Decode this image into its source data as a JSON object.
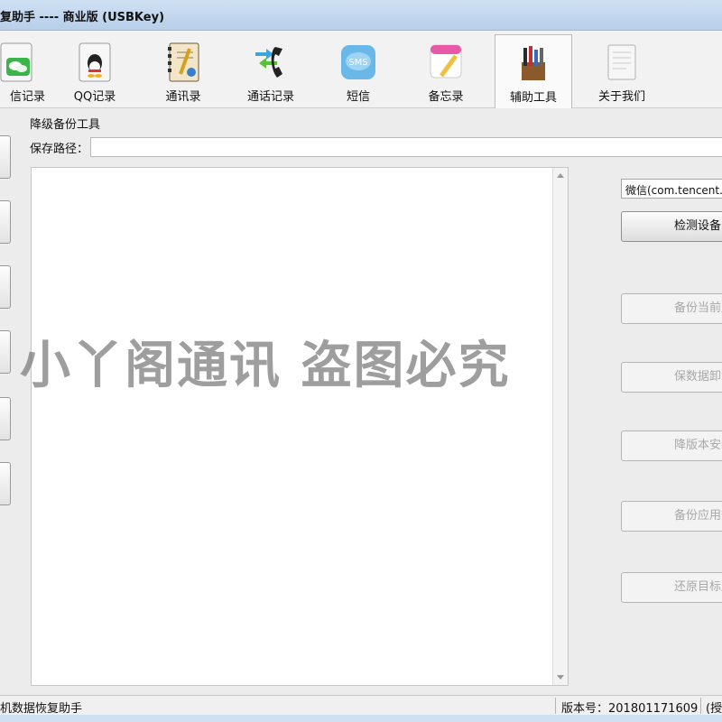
{
  "window": {
    "title": "复助手    ----    商业版 (USBKey)"
  },
  "toolbar": {
    "items": [
      {
        "label": "信记录",
        "icon": "wechat-icon"
      },
      {
        "label": "QQ记录",
        "icon": "qq-icon"
      },
      {
        "label": "通讯录",
        "icon": "contacts-icon"
      },
      {
        "label": "通话记录",
        "icon": "phone-icon"
      },
      {
        "label": "短信",
        "icon": "sms-icon"
      },
      {
        "label": "备忘录",
        "icon": "memo-icon"
      },
      {
        "label": "辅助工具",
        "icon": "tools-icon",
        "active": true
      },
      {
        "label": "关于我们",
        "icon": "about-icon"
      }
    ],
    "sms_icon_text": "SMS"
  },
  "panel": {
    "title": "降级备份工具",
    "save_path_label": "保存路径：",
    "save_path_value": "",
    "app_select_value": "微信(com.tencent.m",
    "buttons": {
      "detect": "检测设备",
      "backup_current": "备份当前应",
      "keep_data_uninstall": "保数据卸载应",
      "downgrade_install": "降版本安装应",
      "backup_app_data": "备份应用数",
      "restore_target": "还原目标应"
    }
  },
  "watermark": "小丫阁通讯 盗图必究",
  "status": {
    "left": "机数据恢复助手",
    "version": "版本号：201801171609",
    "right": "(授"
  },
  "colors": {
    "titlebar": "#cfe0f3",
    "disabled_text": "#a8a8a8",
    "watermark": "#7a7a7a"
  }
}
